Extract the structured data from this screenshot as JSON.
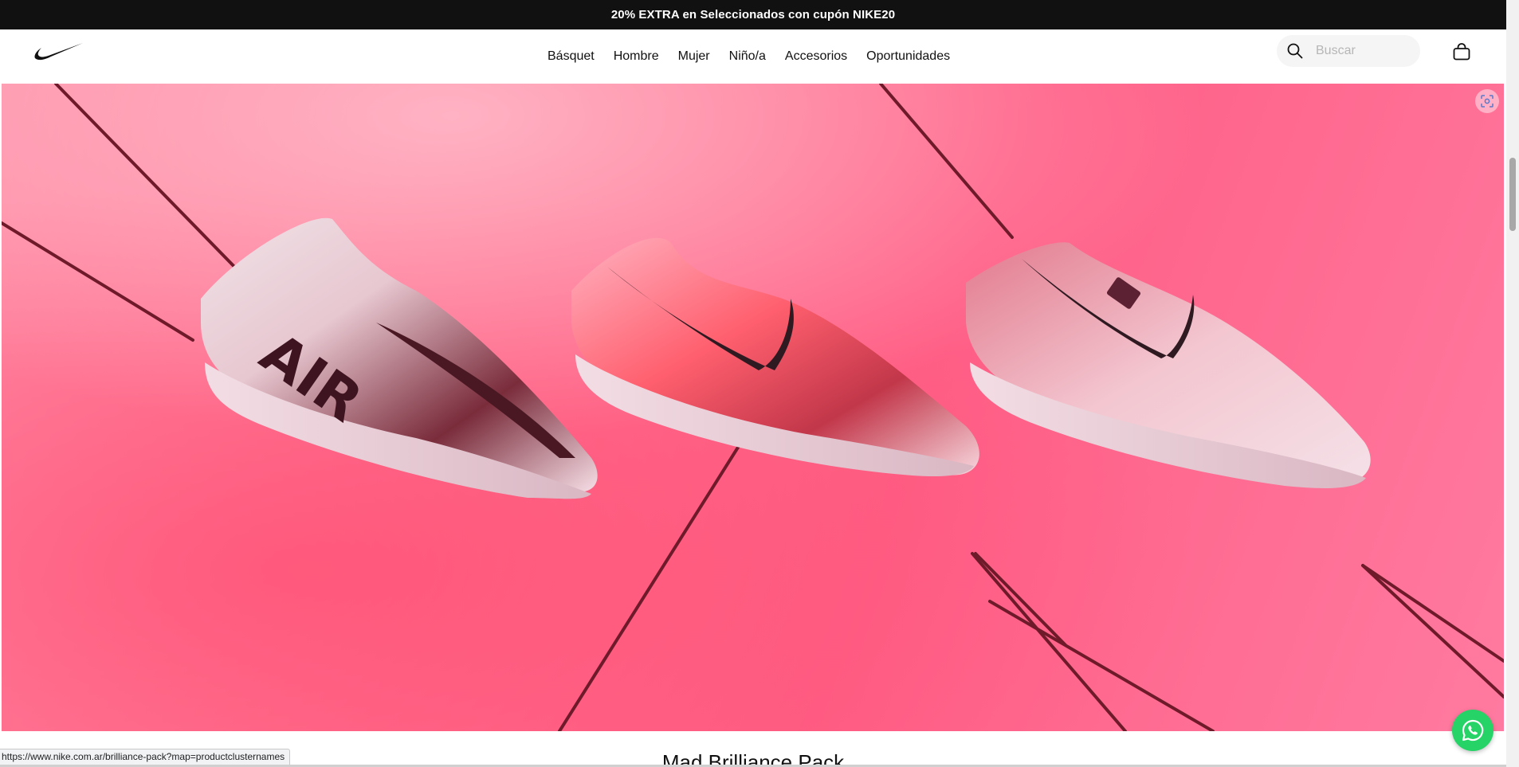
{
  "promo": {
    "text": "20% EXTRA en Seleccionados con cupón NIKE20"
  },
  "header": {
    "logo_icon": "nike-swoosh-icon",
    "nav": [
      {
        "label": "Básquet"
      },
      {
        "label": "Hombre"
      },
      {
        "label": "Mujer"
      },
      {
        "label": "Niño/a"
      },
      {
        "label": "Accesorios"
      },
      {
        "label": "Oportunidades"
      }
    ],
    "search": {
      "placeholder": "Buscar",
      "value": "",
      "icon": "search-icon"
    },
    "bag_icon": "shopping-bag-icon"
  },
  "hero": {
    "image": "three pink football boots suspended on cords",
    "lens_icon": "visual-search-icon"
  },
  "section": {
    "title": "Mad Brilliance Pack"
  },
  "whatsapp": {
    "icon": "whatsapp-icon"
  },
  "status_bar": {
    "url": "https://www.nike.com.ar/brilliance-pack?map=productclusternames"
  },
  "colors": {
    "promo_bg": "#111111",
    "hero_pink": "#ff6f8f",
    "whatsapp_green": "#25d366"
  }
}
